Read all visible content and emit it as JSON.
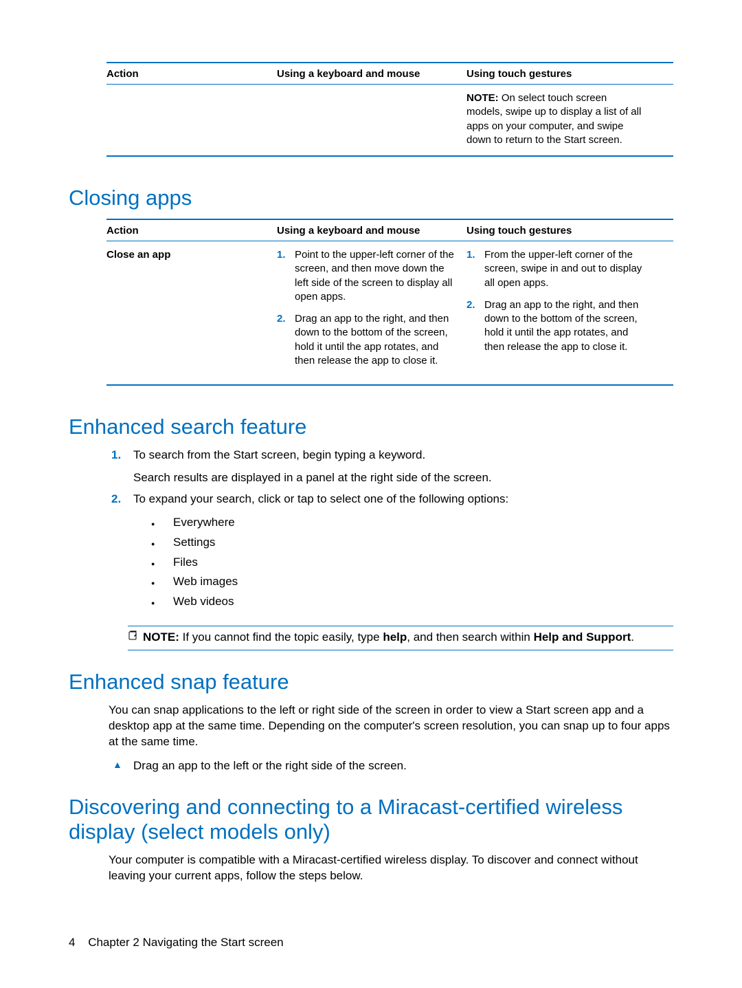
{
  "table1": {
    "headers": {
      "col1": "Action",
      "col2": "Using a keyboard and mouse",
      "col3": "Using touch gestures"
    },
    "row": {
      "note_label": "NOTE:",
      "note_text": "On select touch screen models, swipe up to display a list of all apps on your computer, and swipe down to return to the Start screen."
    }
  },
  "section_closing": {
    "title": "Closing apps",
    "headers": {
      "col1": "Action",
      "col2": "Using a keyboard and mouse",
      "col3": "Using touch gestures"
    },
    "row": {
      "action": "Close an app",
      "keyboard": {
        "step1": "Point to the upper-left corner of the screen, and then move down the left side of the screen to display all open apps.",
        "step2": "Drag an app to the right, and then down to the bottom of the screen, hold it until the app rotates, and then release the app to close it."
      },
      "touch": {
        "step1": "From the upper-left corner of the screen, swipe in and out to display all open apps.",
        "step2": "Drag an app to the right, and then down to the bottom of the screen, hold it until the app rotates, and then release the app to close it."
      }
    }
  },
  "section_search": {
    "title": "Enhanced search feature",
    "step1_a": "To search from the Start screen, begin typing a keyword.",
    "step1_b": "Search results are displayed in a panel at the right side of the screen.",
    "step2": "To expand your search, click or tap to select one of the following options:",
    "options": [
      "Everywhere",
      "Settings",
      "Files",
      "Web images",
      "Web videos"
    ],
    "note_label": "NOTE:",
    "note_text_pre": "If you cannot find the topic easily, type ",
    "note_bold1": "help",
    "note_text_mid": ", and then search within ",
    "note_bold2": "Help and Support",
    "note_text_end": "."
  },
  "section_snap": {
    "title": "Enhanced snap feature",
    "para": "You can snap applications to the left or right side of the screen in order to view a Start screen app and a desktop app at the same time. Depending on the computer's screen resolution, you can snap up to four apps at the same time.",
    "bullet": "Drag an app to the left or the right side of the screen."
  },
  "section_miracast": {
    "title": "Discovering and connecting to a Miracast-certified wireless display (select models only)",
    "para": "Your computer is compatible with a Miracast-certified wireless display. To discover and connect without leaving your current apps, follow the steps below."
  },
  "footer": {
    "page": "4",
    "chapter": "Chapter 2   Navigating the Start screen"
  }
}
